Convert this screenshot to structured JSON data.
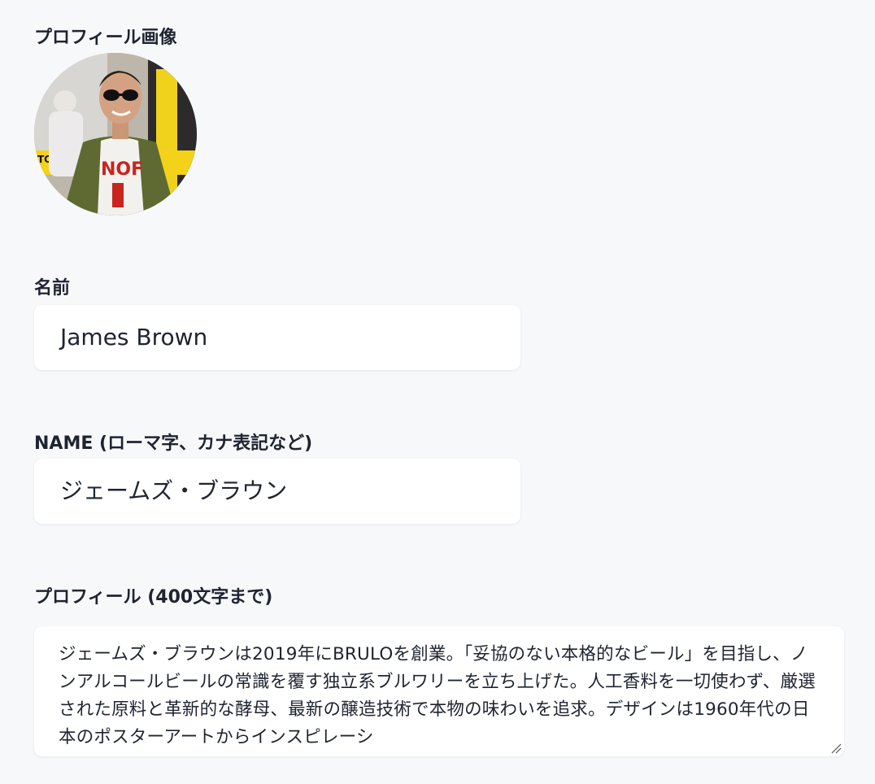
{
  "profile_image": {
    "label": "プロフィール画像",
    "icon": "avatar-photo"
  },
  "name_field": {
    "label": "名前",
    "value": "James Brown"
  },
  "alt_name_field": {
    "label": "NAME (ローマ字、カナ表記など)",
    "value": "ジェームズ・ブラウン"
  },
  "bio_field": {
    "label": "プロフィール (400文字まで)",
    "value": "ジェームズ・ブラウンは2019年にBRULOを創業。「妥協のない本格的なビール」を目指し、ノンアルコールビールの常識を覆す独立系ブルワリーを立ち上げた。人工香料を一切使わず、厳選された原料と革新的な酵母、最新の醸造技術で本物の味わいを追求。デザインは1960年代の日本のポスターアートからインスピレーシ"
  },
  "colors": {
    "background": "#f7f8fa",
    "field_background": "#ffffff",
    "text": "#1e2430"
  }
}
